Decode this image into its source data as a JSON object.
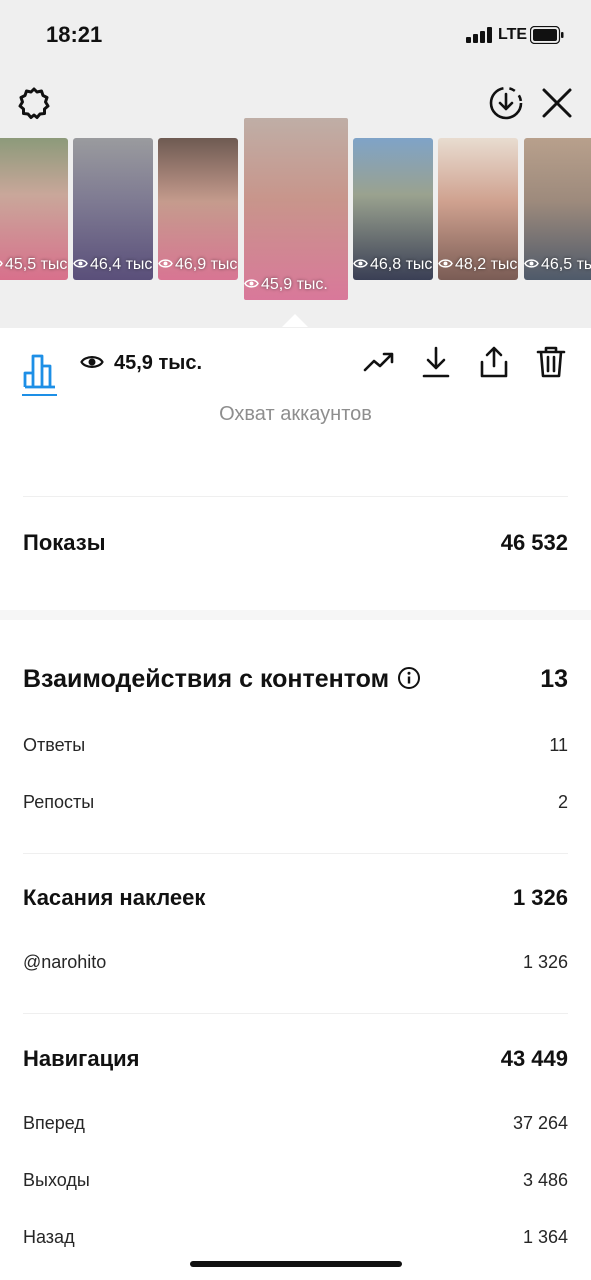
{
  "status_bar": {
    "time": "18:21",
    "network": "LTE"
  },
  "top_bar": {
    "settings_icon": "gear-icon",
    "download_icon": "download-circle-icon",
    "close_icon": "close-icon"
  },
  "thumbnails": [
    {
      "views": "45,5 тыс",
      "selected": false
    },
    {
      "views": "46,4 тыс",
      "selected": false
    },
    {
      "views": "46,9 тыс",
      "selected": false
    },
    {
      "views": "45,9 тыс.",
      "selected": true
    },
    {
      "views": "46,8 тыс",
      "selected": false
    },
    {
      "views": "48,2 тыс",
      "selected": false
    },
    {
      "views": "46,5 тыс",
      "selected": false
    }
  ],
  "toolbar": {
    "views": "45,9 тыс.",
    "icons": [
      "bar-chart-icon",
      "eye-icon",
      "trend-icon",
      "download-icon",
      "share-icon",
      "trash-icon"
    ]
  },
  "reach": {
    "label": "Охват аккаунтов"
  },
  "impressions": {
    "label": "Показы",
    "value": "46 532"
  },
  "interactions": {
    "label": "Взаимодействия с контентом",
    "value": "13",
    "items": [
      {
        "label": "Ответы",
        "value": "11"
      },
      {
        "label": "Репосты",
        "value": "2"
      }
    ]
  },
  "sticker_taps": {
    "label": "Касания наклеек",
    "value": "1 326",
    "items": [
      {
        "label": "@narohito",
        "value": "1 326"
      }
    ]
  },
  "navigation": {
    "label": "Навигация",
    "value": "43 449",
    "items": [
      {
        "label": "Вперед",
        "value": "37 264"
      },
      {
        "label": "Выходы",
        "value": "3 486"
      },
      {
        "label": "Назад",
        "value": "1 364"
      }
    ]
  },
  "colors": {
    "accent": "#1d8fe6",
    "muted_text": "#8e8e8e"
  }
}
